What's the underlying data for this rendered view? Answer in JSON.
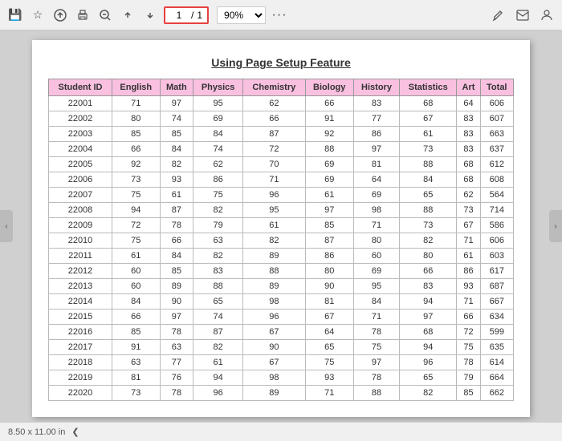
{
  "toolbar": {
    "page_current": "1",
    "page_total": "1",
    "page_separator": "/",
    "zoom_value": "90%",
    "more_label": "···"
  },
  "document": {
    "title": "Using Page Setup Feature",
    "columns": [
      "Student ID",
      "English",
      "Math",
      "Physics",
      "Chemistry",
      "Biology",
      "History",
      "Statistics",
      "Art",
      "Total"
    ],
    "rows": [
      [
        "22001",
        "71",
        "97",
        "95",
        "62",
        "66",
        "83",
        "68",
        "64",
        "606"
      ],
      [
        "22002",
        "80",
        "74",
        "69",
        "66",
        "91",
        "77",
        "67",
        "83",
        "607"
      ],
      [
        "22003",
        "85",
        "85",
        "84",
        "87",
        "92",
        "86",
        "61",
        "83",
        "663"
      ],
      [
        "22004",
        "66",
        "84",
        "74",
        "72",
        "88",
        "97",
        "73",
        "83",
        "637"
      ],
      [
        "22005",
        "92",
        "82",
        "62",
        "70",
        "69",
        "81",
        "88",
        "68",
        "612"
      ],
      [
        "22006",
        "73",
        "93",
        "86",
        "71",
        "69",
        "64",
        "84",
        "68",
        "608"
      ],
      [
        "22007",
        "75",
        "61",
        "75",
        "96",
        "61",
        "69",
        "65",
        "62",
        "564"
      ],
      [
        "22008",
        "94",
        "87",
        "82",
        "95",
        "97",
        "98",
        "88",
        "73",
        "714"
      ],
      [
        "22009",
        "72",
        "78",
        "79",
        "61",
        "85",
        "71",
        "73",
        "67",
        "586"
      ],
      [
        "22010",
        "75",
        "66",
        "63",
        "82",
        "87",
        "80",
        "82",
        "71",
        "606"
      ],
      [
        "22011",
        "61",
        "84",
        "82",
        "89",
        "86",
        "60",
        "80",
        "61",
        "603"
      ],
      [
        "22012",
        "60",
        "85",
        "83",
        "88",
        "80",
        "69",
        "66",
        "86",
        "617"
      ],
      [
        "22013",
        "60",
        "89",
        "88",
        "89",
        "90",
        "95",
        "83",
        "93",
        "687"
      ],
      [
        "22014",
        "84",
        "90",
        "65",
        "98",
        "81",
        "84",
        "94",
        "71",
        "667"
      ],
      [
        "22015",
        "66",
        "97",
        "74",
        "96",
        "67",
        "71",
        "97",
        "66",
        "634"
      ],
      [
        "22016",
        "85",
        "78",
        "87",
        "67",
        "64",
        "78",
        "68",
        "72",
        "599"
      ],
      [
        "22017",
        "91",
        "63",
        "82",
        "90",
        "65",
        "75",
        "94",
        "75",
        "635"
      ],
      [
        "22018",
        "63",
        "77",
        "61",
        "67",
        "75",
        "97",
        "96",
        "78",
        "614"
      ],
      [
        "22019",
        "81",
        "76",
        "94",
        "98",
        "93",
        "78",
        "65",
        "79",
        "664"
      ],
      [
        "22020",
        "73",
        "78",
        "96",
        "89",
        "71",
        "88",
        "82",
        "85",
        "662"
      ]
    ]
  },
  "status_bar": {
    "page_size": "8.50 x 11.00 in"
  },
  "icons": {
    "save": "💾",
    "bookmark": "☆",
    "upload": "⬆",
    "print": "🖨",
    "zoom_in": "🔍",
    "nav_up": "⬆",
    "nav_down": "⬇",
    "more": "···",
    "left_arrow": "‹",
    "right_arrow": "›",
    "annotation": "✏",
    "email": "✉",
    "user": "👤"
  }
}
